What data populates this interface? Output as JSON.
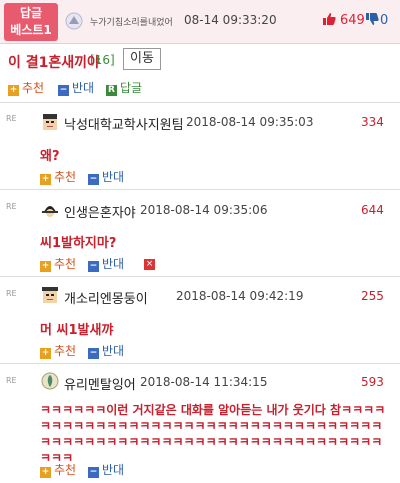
{
  "best": {
    "badge_line1": "답글",
    "badge_line2": "베스트1",
    "user": "누가기침소리를내었어",
    "time": "08-14 09:33:20",
    "up_icon": "thumbs-up-icon",
    "up_count": "649",
    "down_icon": "thumbs-down-icon",
    "down_count": "0"
  },
  "post": {
    "title": "이 결1혼새끼야",
    "count": "[16]",
    "move_label": "이동"
  },
  "post_actions": {
    "up_label": "추천",
    "down_label": "반대",
    "reply_label": "답글",
    "up_icon_char": "+",
    "down_icon_char": "−",
    "reply_icon_char": "R"
  },
  "replies": [
    {
      "mark": "RE",
      "user": "낙성대학교학사지원팀",
      "time": "2018-08-14 09:35:03",
      "score": "334",
      "body": "왜?",
      "up_label": "추천",
      "down_label": "반대"
    },
    {
      "mark": "RE",
      "user": "인생은혼자야",
      "time": "2018-08-14 09:35:06",
      "score": "644",
      "body": "씨1발하지마?",
      "up_label": "추천",
      "down_label": "반대",
      "delete_icon": "×"
    },
    {
      "mark": "RE",
      "user": "개소리엔몽둥이",
      "time": "2018-08-14 09:42:19",
      "score": "255",
      "body": "머 씨1발새꺄",
      "up_label": "추천",
      "down_label": "반대"
    },
    {
      "mark": "RE",
      "user": "유리멘탈잉어",
      "time": "2018-08-14 11:34:15",
      "score": "593",
      "body": "ㅋㅋㅋㅋㅋㅋ이런 거지같은 대화를 알아듣는 내가 웃기다 참ㅋㅋㅋㅋㅋㅋㅋㅋㅋㅋㅋㅋㅋㅋㅋㅋㅋㅋㅋㅋㅋㅋㅋㅋㅋㅋㅋㅋㅋㅋㅋㅋㅋㅋㅋㅋㅋㅋㅋㅋㅋㅋㅋㅋㅋㅋㅋㅋㅋㅋㅋㅋㅋㅋㅋㅋㅋㅋㅋㅋㅋㅋㅋㅋㅋㅋㅋㅋㅋ",
      "up_label": "추천",
      "down_label": "반대"
    }
  ],
  "colors": {
    "accent_red": "#c8202d",
    "badge_pink": "#e85a6e",
    "down_blue": "#2b5fa8",
    "up_orange": "#e8a020"
  }
}
